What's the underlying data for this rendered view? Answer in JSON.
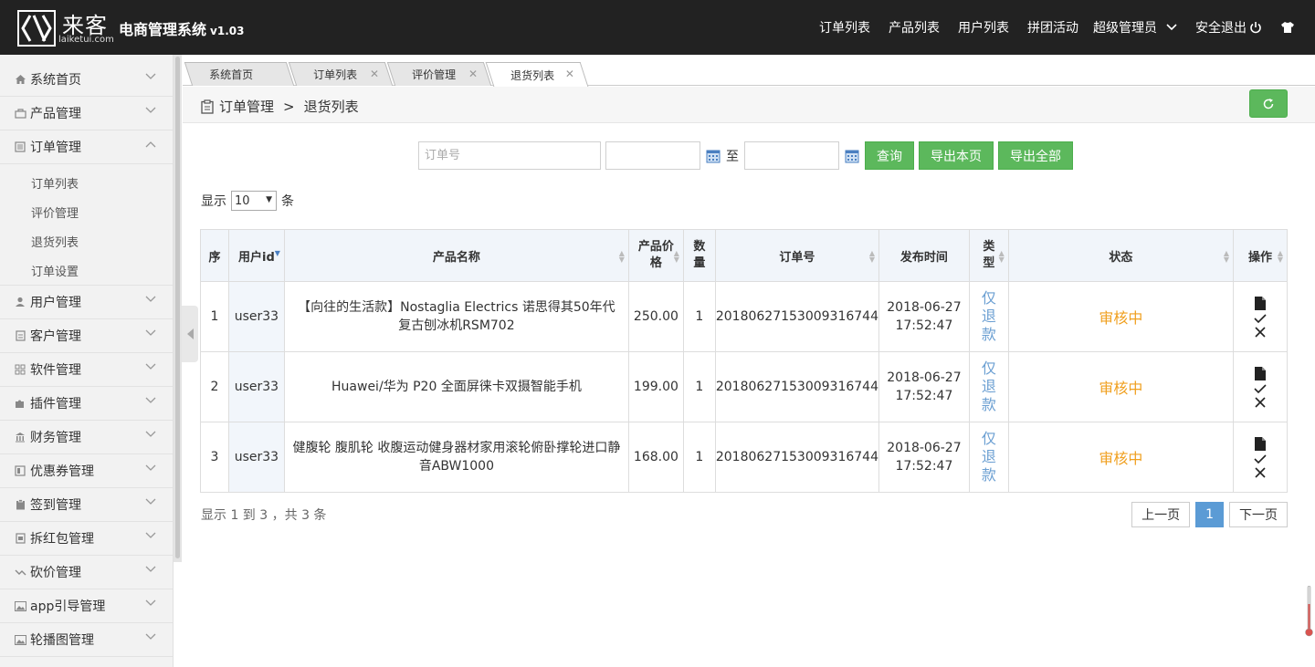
{
  "brand": {
    "logo_cn": "来客",
    "logo_en": "laiketui.com",
    "title": "电商管理系统",
    "version": "v1.03"
  },
  "topnav": {
    "order_list": "订单列表",
    "product_list": "产品列表",
    "user_list": "用户列表",
    "group_buy": "拼团活动",
    "admin": "超级管理员",
    "logout": "安全退出"
  },
  "sidebar": {
    "items": [
      {
        "label": "系统首页",
        "icon": "home-icon"
      },
      {
        "label": "产品管理",
        "icon": "bag-icon"
      },
      {
        "label": "订单管理",
        "icon": "list-icon"
      },
      {
        "label": "用户管理",
        "icon": "user-icon"
      },
      {
        "label": "客户管理",
        "icon": "doc-icon"
      },
      {
        "label": "软件管理",
        "icon": "grid-icon"
      },
      {
        "label": "插件管理",
        "icon": "puzzle-icon"
      },
      {
        "label": "财务管理",
        "icon": "bank-icon"
      },
      {
        "label": "优惠券管理",
        "icon": "coupon-icon"
      },
      {
        "label": "签到管理",
        "icon": "clipboard-icon"
      },
      {
        "label": "拆红包管理",
        "icon": "envelope-icon"
      },
      {
        "label": "砍价管理",
        "icon": "trend-icon"
      },
      {
        "label": "app引导管理",
        "icon": "image-icon"
      },
      {
        "label": "轮播图管理",
        "icon": "image-icon"
      }
    ],
    "order_sub": [
      "订单列表",
      "评价管理",
      "退货列表",
      "订单设置"
    ]
  },
  "tabs": [
    "系统首页",
    "订单列表",
    "评价管理",
    "退货列表"
  ],
  "breadcrumb": {
    "parent": "订单管理",
    "sep": ">",
    "current": "退货列表"
  },
  "search": {
    "order_placeholder": "订单号",
    "to": "至",
    "query": "查询",
    "export_page": "导出本页",
    "export_all": "导出全部"
  },
  "page_size": {
    "prefix": "显示",
    "value": "10",
    "suffix": "条"
  },
  "table": {
    "headers": {
      "idx": "序",
      "uid": "用户id",
      "name": "产品名称",
      "price": "产品价格",
      "qty": "数量",
      "order_no": "订单号",
      "time": "发布时间",
      "type": "类型",
      "status": "状态",
      "ops": "操作"
    },
    "rows": [
      {
        "idx": "1",
        "uid": "user33",
        "name": "【向往的生活款】Nostaglia Electrics 诺思得其50年代复古刨冰机RSM702",
        "price": "250.00",
        "qty": "1",
        "order_no": "20180627153009316744",
        "date": "2018-06-27",
        "time": "17:52:47",
        "type": "仅退款",
        "status": "审核中"
      },
      {
        "idx": "2",
        "uid": "user33",
        "name": "Huawei/华为 P20 全面屏徕卡双摄智能手机",
        "price": "199.00",
        "qty": "1",
        "order_no": "20180627153009316744",
        "date": "2018-06-27",
        "time": "17:52:47",
        "type": "仅退款",
        "status": "审核中"
      },
      {
        "idx": "3",
        "uid": "user33",
        "name": "健腹轮 腹肌轮 收腹运动健身器材家用滚轮俯卧撑轮进口静音ABW1000",
        "price": "168.00",
        "qty": "1",
        "order_no": "20180627153009316744",
        "date": "2018-06-27",
        "time": "17:52:47",
        "type": "仅退款",
        "status": "审核中"
      }
    ]
  },
  "footer": {
    "info": "显示 1 到 3 ，共 3 条",
    "prev": "上一页",
    "current": "1",
    "next": "下一页"
  },
  "colors": {
    "topbar": "#222222",
    "green": "#5cb85c",
    "link": "#6b9fd2",
    "status": "#f0a020",
    "page_active": "#5b9bd5"
  }
}
